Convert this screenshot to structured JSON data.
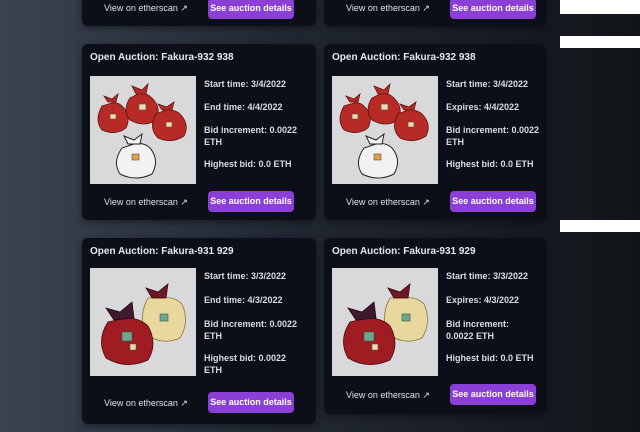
{
  "cards": [
    {
      "view_link": "View on etherscan ↗",
      "button": "See auction details"
    },
    {
      "view_link": "View on etherscan ↗",
      "button": "See auction details"
    },
    {
      "title": "Open Auction: Fakura-932 938",
      "start": "Start time: 3/4/2022",
      "end": "End time: 4/4/2022",
      "increment": "Bid increment: 0.0022 ETH",
      "highest": "Highest bid: 0.0 ETH",
      "view_link": "View on etherscan ↗",
      "button": "See auction details"
    },
    {
      "title": "Open Auction: Fakura-932 938",
      "start": "Start time: 3/4/2022",
      "end": "Expires: 4/4/2022",
      "increment": "Bid increment: 0.0022 ETH",
      "highest": "Highest bid: 0.0 ETH",
      "view_link": "View on etherscan ↗",
      "button": "See auction details"
    },
    {
      "title": "Open Auction: Fakura-931 929",
      "start": "Start time: 3/3/2022",
      "end": "End time: 4/3/2022",
      "increment": "Bid increment: 0.0022 ETH",
      "highest": "Highest bid: 0.0022 ETH",
      "view_link": "View on etherscan ↗",
      "button": "See auction details"
    },
    {
      "title": "Open Auction: Fakura-931 929",
      "start": "Start time: 3/3/2022",
      "end": "Expires: 4/3/2022",
      "increment": "Bid increment: 0.0022 ETH",
      "highest": "Highest bid: 0.0 ETH",
      "view_link": "View on etherscan ↗",
      "button": "See auction details"
    }
  ]
}
